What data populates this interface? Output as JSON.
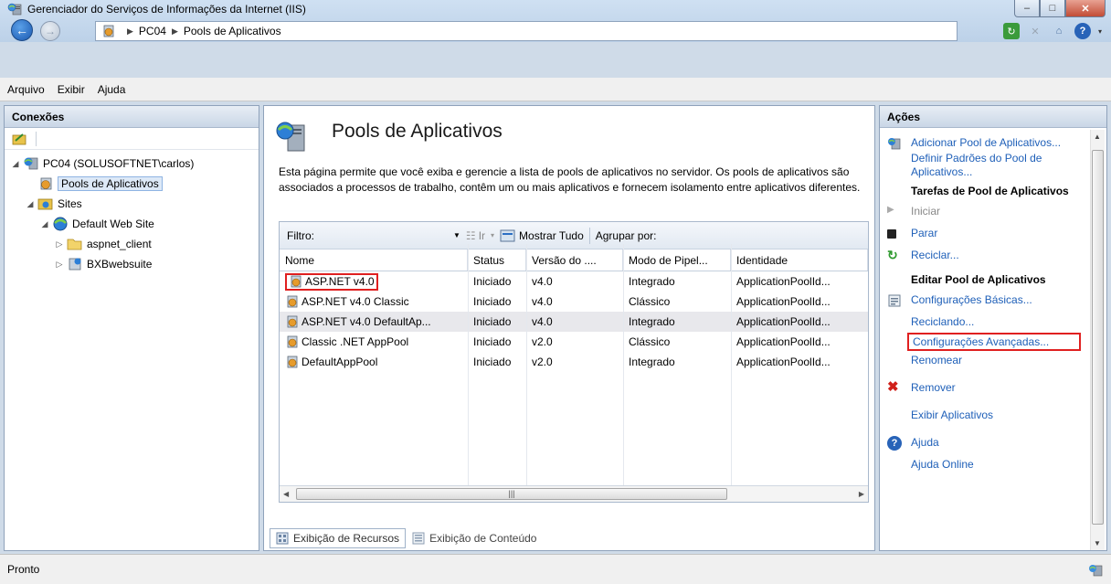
{
  "window": {
    "title": "Gerenciador do Serviços de Informações da Internet (IIS)",
    "minimize": "–",
    "maximize": "□",
    "close": "✕"
  },
  "address": {
    "crumbs": [
      "PC04",
      "Pools de Aplicativos"
    ],
    "separator": "▶"
  },
  "menu": {
    "items": [
      "Arquivo",
      "Exibir",
      "Ajuda"
    ]
  },
  "connections": {
    "header": "Conexões",
    "tree": [
      {
        "label": "PC04 (SOLUSOFTNET\\carlos)",
        "indent": 0,
        "expander": "◢",
        "icon": "server-icon"
      },
      {
        "label": "Pools de Aplicativos",
        "indent": 1,
        "expander": "",
        "icon": "app-pool-icon",
        "selected": true
      },
      {
        "label": "Sites",
        "indent": 1,
        "expander": "◢",
        "icon": "sites-folder-icon"
      },
      {
        "label": "Default Web Site",
        "indent": 2,
        "expander": "◢",
        "icon": "globe-icon"
      },
      {
        "label": "aspnet_client",
        "indent": 3,
        "expander": "▷",
        "icon": "folder-icon"
      },
      {
        "label": "BXBwebsuite",
        "indent": 3,
        "expander": "▷",
        "icon": "app-icon"
      }
    ]
  },
  "main": {
    "title": "Pools de Aplicativos",
    "description": "Esta página permite que você exiba e gerencie a lista de pools de aplicativos no servidor. Os pools de aplicativos são associados a processos de trabalho, contêm um ou mais aplicativos e fornecem isolamento entre aplicativos diferentes.",
    "toolbar": {
      "filter_label": "Filtro:",
      "go": "Ir",
      "show_all": "Mostrar Tudo",
      "group_by": "Agrupar por:"
    },
    "columns": [
      "Nome",
      "Status",
      "Versão do ....",
      "Modo de Pipel...",
      "Identidade"
    ],
    "rows": [
      [
        "ASP.NET v4.0",
        "Iniciado",
        "v4.0",
        "Integrado",
        "ApplicationPoolId..."
      ],
      [
        "ASP.NET v4.0 Classic",
        "Iniciado",
        "v4.0",
        "Clássico",
        "ApplicationPoolId..."
      ],
      [
        "ASP.NET v4.0 DefaultAp...",
        "Iniciado",
        "v4.0",
        "Integrado",
        "ApplicationPoolId..."
      ],
      [
        "Classic .NET AppPool",
        "Iniciado",
        "v2.0",
        "Clássico",
        "ApplicationPoolId..."
      ],
      [
        "DefaultAppPool",
        "Iniciado",
        "v2.0",
        "Integrado",
        "ApplicationPoolId..."
      ]
    ],
    "scroll_grip": "|||",
    "views": [
      "Exibição de Recursos",
      "Exibição de Conteúdo"
    ]
  },
  "actions": {
    "header": "Ações",
    "add_pool": "Adicionar Pool de Aplicativos...",
    "set_defaults": "Definir Padrões do Pool de Aplicativos...",
    "group_tasks": "Tarefas de Pool de Aplicativos",
    "start": "Iniciar",
    "stop": "Parar",
    "recycle": "Reciclar...",
    "group_edit": "Editar Pool de Aplicativos",
    "basic_settings": "Configurações Básicas...",
    "recycling": "Reciclando...",
    "advanced_settings": "Configurações Avançadas...",
    "rename": "Renomear",
    "remove": "Remover",
    "view_apps": "Exibir Aplicativos",
    "help": "Ajuda",
    "help_online": "Ajuda Online"
  },
  "status": {
    "text": "Pronto"
  }
}
